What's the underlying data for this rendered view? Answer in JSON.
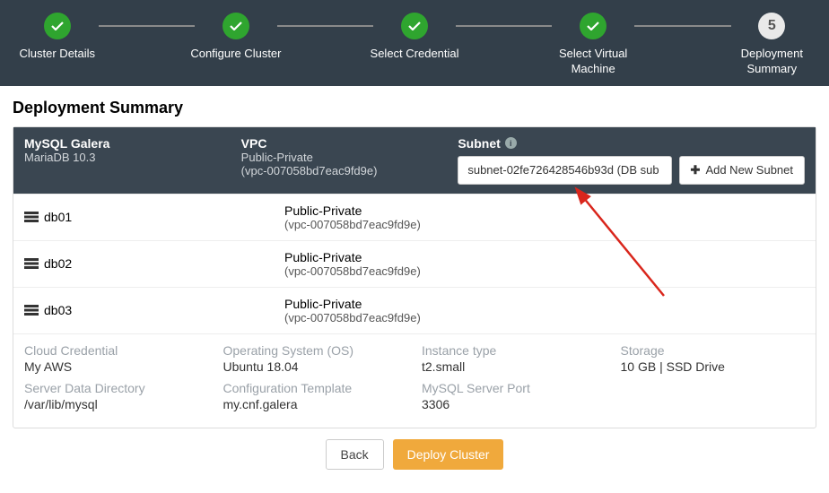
{
  "stepper": {
    "steps": [
      {
        "label": "Cluster Details",
        "state": "done"
      },
      {
        "label": "Configure Cluster",
        "state": "done"
      },
      {
        "label": "Select Credential",
        "state": "done"
      },
      {
        "label": "Select Virtual Machine",
        "state": "done"
      },
      {
        "label": "Deployment Summary",
        "state": "current",
        "number": "5"
      }
    ]
  },
  "title": "Deployment Summary",
  "header": {
    "cluster_title": "MySQL Galera",
    "cluster_sub": "MariaDB 10.3",
    "vpc_label": "VPC",
    "vpc_name": "Public-Private",
    "vpc_id": "(vpc-007058bd7eac9fd9e)",
    "subnet_label": "Subnet",
    "subnet_value": "subnet-02fe726428546b93d (DB sub",
    "add_subnet": "Add New Subnet"
  },
  "dbs": [
    {
      "name": "db01",
      "vpc_name": "Public-Private",
      "vpc_id": "(vpc-007058bd7eac9fd9e)"
    },
    {
      "name": "db02",
      "vpc_name": "Public-Private",
      "vpc_id": "(vpc-007058bd7eac9fd9e)"
    },
    {
      "name": "db03",
      "vpc_name": "Public-Private",
      "vpc_id": "(vpc-007058bd7eac9fd9e)"
    }
  ],
  "meta": {
    "cloud_credential": {
      "label": "Cloud Credential",
      "value": "My AWS"
    },
    "os": {
      "label": "Operating System (OS)",
      "value": "Ubuntu 18.04"
    },
    "instance": {
      "label": "Instance type",
      "value": "t2.small"
    },
    "storage": {
      "label": "Storage",
      "value": "10 GB | SSD Drive"
    },
    "data_dir": {
      "label": "Server Data Directory",
      "value": "/var/lib/mysql"
    },
    "config_tpl": {
      "label": "Configuration Template",
      "value": "my.cnf.galera"
    },
    "port": {
      "label": "MySQL Server Port",
      "value": "3306"
    }
  },
  "actions": {
    "back": "Back",
    "deploy": "Deploy Cluster"
  }
}
